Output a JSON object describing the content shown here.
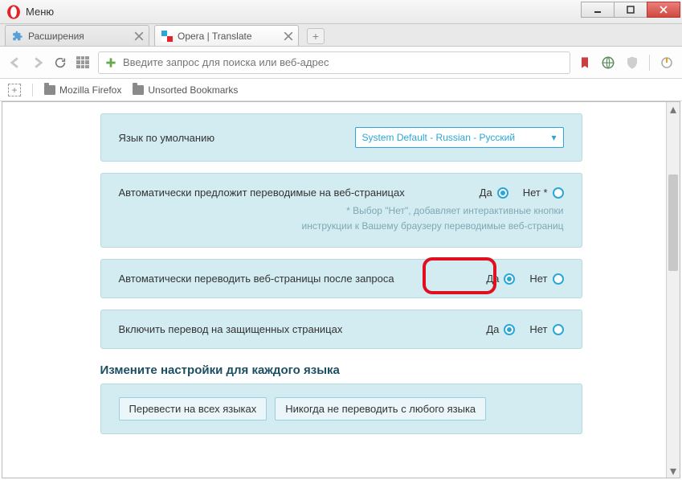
{
  "titlebar": {
    "menu": "Меню"
  },
  "tabs": [
    {
      "title": "Расширения"
    },
    {
      "title": "Opera | Translate"
    }
  ],
  "address": {
    "placeholder": "Введите запрос для поиска или веб-адрес"
  },
  "bookmarks": [
    {
      "label": "Mozilla Firefox"
    },
    {
      "label": "Unsorted Bookmarks"
    }
  ],
  "settings": {
    "default_lang_label": "Язык по умолчанию",
    "default_lang_value": "System Default - Russian - Русский",
    "s1": {
      "title": "Автоматически предложит переводимые на веб-страницах",
      "note1": "* Выбор \"Нет\", добавляет интерактивные кнопки",
      "note2": "инструкции к Вашему браузеру переводимые веб-страниц",
      "yes": "Да",
      "no": "Нет *"
    },
    "s2": {
      "title": "Автоматически переводить веб-страницы после запроса",
      "yes": "Да",
      "no": "Нет"
    },
    "s3": {
      "title": "Включить перевод на защищенных страницах",
      "yes": "Да",
      "no": "Нет"
    },
    "per_lang_heading": "Измените настройки для каждого языка",
    "btn_all": "Перевести на всех языках",
    "btn_never": "Никогда не переводить с любого языка"
  }
}
